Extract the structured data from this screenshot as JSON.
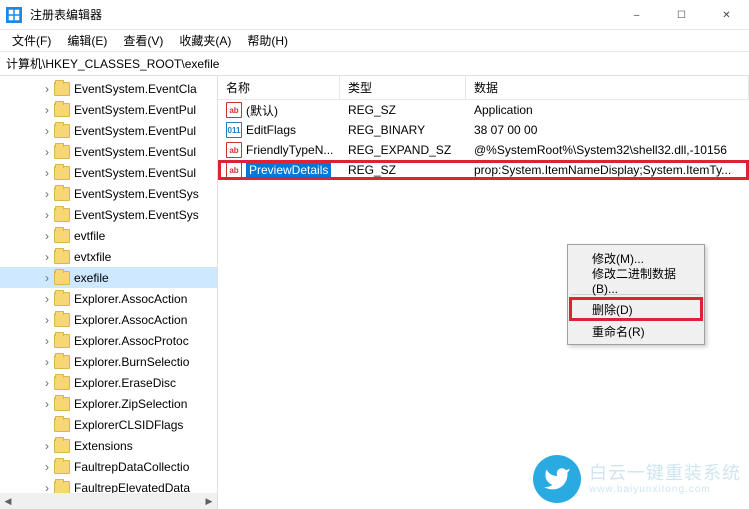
{
  "window": {
    "title": "注册表编辑器",
    "minimize": "–",
    "maximize": "☐",
    "close": "✕"
  },
  "menu": {
    "file": "文件(F)",
    "edit": "编辑(E)",
    "view": "查看(V)",
    "favorites": "收藏夹(A)",
    "help": "帮助(H)"
  },
  "address": "计算机\\HKEY_CLASSES_ROOT\\exefile",
  "tree": {
    "items": [
      {
        "label": "EventSystem.EventCla",
        "expandable": true
      },
      {
        "label": "EventSystem.EventPul",
        "expandable": true
      },
      {
        "label": "EventSystem.EventPul",
        "expandable": true
      },
      {
        "label": "EventSystem.EventSul",
        "expandable": true
      },
      {
        "label": "EventSystem.EventSul",
        "expandable": true
      },
      {
        "label": "EventSystem.EventSys",
        "expandable": true
      },
      {
        "label": "EventSystem.EventSys",
        "expandable": true
      },
      {
        "label": "evtfile",
        "expandable": true
      },
      {
        "label": "evtxfile",
        "expandable": true
      },
      {
        "label": "exefile",
        "expandable": true,
        "selected": true
      },
      {
        "label": "Explorer.AssocAction",
        "expandable": true
      },
      {
        "label": "Explorer.AssocAction",
        "expandable": true
      },
      {
        "label": "Explorer.AssocProtoc",
        "expandable": true
      },
      {
        "label": "Explorer.BurnSelectio",
        "expandable": true
      },
      {
        "label": "Explorer.EraseDisc",
        "expandable": true
      },
      {
        "label": "Explorer.ZipSelection",
        "expandable": true
      },
      {
        "label": "ExplorerCLSIDFlags",
        "expandable": false
      },
      {
        "label": "Extensions",
        "expandable": true
      },
      {
        "label": "FaultrepDataCollectio",
        "expandable": true
      },
      {
        "label": "FaultrepElevatedData",
        "expandable": true
      }
    ]
  },
  "columns": {
    "name": "名称",
    "type": "类型",
    "data": "数据"
  },
  "values": [
    {
      "name": "(默认)",
      "icon": "str",
      "type": "REG_SZ",
      "data": "Application"
    },
    {
      "name": "EditFlags",
      "icon": "bin",
      "type": "REG_BINARY",
      "data": "38 07 00 00"
    },
    {
      "name": "FriendlyTypeN...",
      "icon": "str",
      "type": "REG_EXPAND_SZ",
      "data": "@%SystemRoot%\\System32\\shell32.dll,-10156"
    },
    {
      "name": "PreviewDetails",
      "icon": "str",
      "type": "REG_SZ",
      "data": "prop:System.ItemNameDisplay;System.ItemTy...",
      "selected": true
    }
  ],
  "context_menu": {
    "modify": "修改(M)...",
    "modify_binary": "修改二进制数据(B)...",
    "delete": "删除(D)",
    "rename": "重命名(R)"
  },
  "watermark": {
    "title": "白云一键重装系统",
    "url": "www.baiyunxitong.com"
  }
}
